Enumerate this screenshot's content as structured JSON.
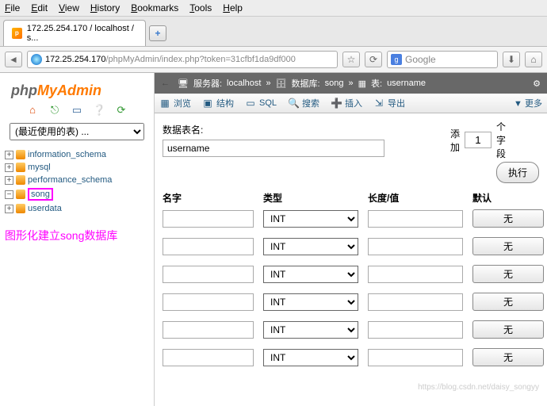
{
  "menu": [
    "File",
    "Edit",
    "View",
    "History",
    "Bookmarks",
    "Tools",
    "Help"
  ],
  "tab_title": "172.25.254.170 / localhost / s...",
  "url_host": "172.25.254.170",
  "url_path": "/phpMyAdmin/index.php?token=31cfbf1da9df000",
  "search_engine": "g",
  "search_placeholder": "Google",
  "logo": {
    "p1": "php",
    "p2": "MyAdmin"
  },
  "recent_placeholder": "(最近使用的表) ...",
  "databases": [
    "information_schema",
    "mysql",
    "performance_schema",
    "song",
    "userdata"
  ],
  "highlighted_db_index": 3,
  "annotation": "图形化建立song数据库",
  "breadcrumb": {
    "server_lbl": "服务器:",
    "server": "localhost",
    "db_lbl": "数据库:",
    "db": "song",
    "tbl_lbl": "表:",
    "tbl": "username"
  },
  "maintabs": [
    {
      "icon": "▦",
      "label": "浏览"
    },
    {
      "icon": "▣",
      "label": "结构"
    },
    {
      "icon": "▭",
      "label": "SQL"
    },
    {
      "icon": "🔍",
      "label": "搜索"
    },
    {
      "icon": "➕",
      "label": "插入"
    },
    {
      "icon": "⇲",
      "label": "导出"
    }
  ],
  "more_label": "更多",
  "form": {
    "tablename_label": "数据表名:",
    "tablename_value": "username",
    "add_label": "添加",
    "add_count": "1",
    "fields_label": "个字段",
    "exec_label": "执行",
    "headers": {
      "name": "名字",
      "type": "类型",
      "length": "长度/值",
      "default": "默认"
    },
    "type_default": "INT",
    "default_btn": "无",
    "row_count": 6
  },
  "watermark": "https://blog.csdn.net/daisy_songyy"
}
